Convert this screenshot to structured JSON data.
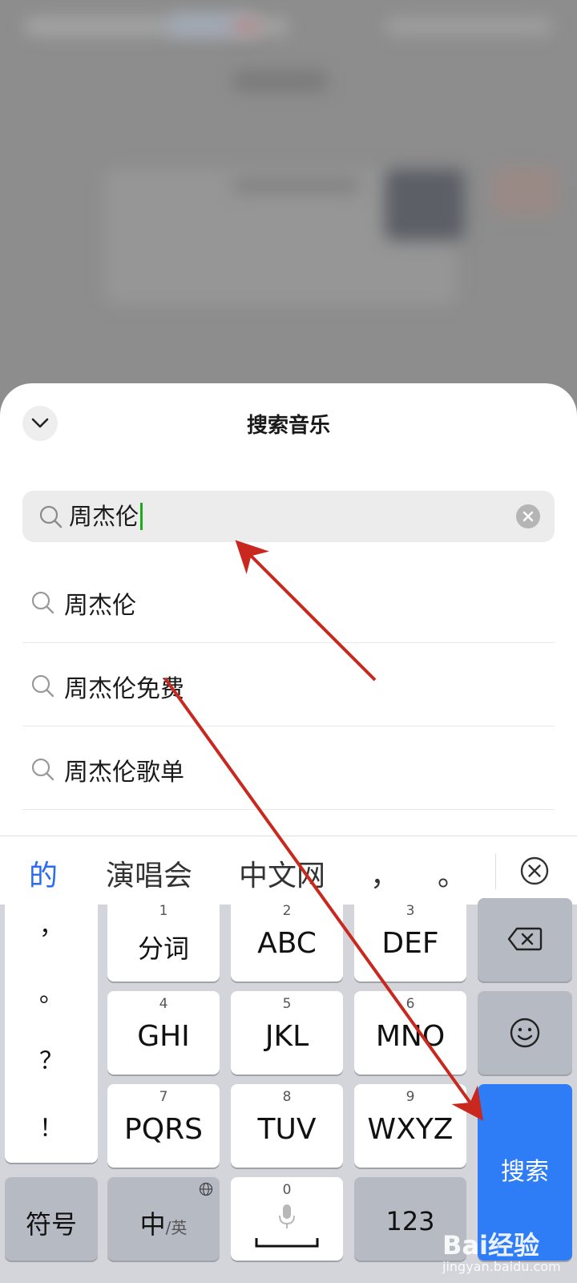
{
  "sheet": {
    "title": "搜索音乐"
  },
  "search": {
    "value": "周杰伦"
  },
  "suggestions": [
    {
      "label": "周杰伦"
    },
    {
      "label": "周杰伦免费"
    },
    {
      "label": "周杰伦歌单"
    }
  ],
  "candidates": [
    "的",
    "演唱会",
    "中文网",
    "，",
    "。"
  ],
  "keyboard": {
    "punct": [
      "，",
      "。",
      "？",
      "！"
    ],
    "keys": [
      {
        "num": "1",
        "label": "分词"
      },
      {
        "num": "2",
        "label": "ABC"
      },
      {
        "num": "3",
        "label": "DEF"
      },
      {
        "num": "4",
        "label": "GHI"
      },
      {
        "num": "5",
        "label": "JKL"
      },
      {
        "num": "6",
        "label": "MNO"
      },
      {
        "num": "7",
        "label": "PQRS"
      },
      {
        "num": "8",
        "label": "TUV"
      },
      {
        "num": "9",
        "label": "WXYZ"
      }
    ],
    "symbol_label": "符号",
    "lang_label": "中",
    "lang_alt": "/英",
    "space_num": "0",
    "num_label": "123",
    "search_label": "搜索"
  },
  "watermark": {
    "logo": "Bai经验",
    "url": "jingyan.baidu.com"
  },
  "colors": {
    "accent_blue": "#2e7cf6",
    "candidate_highlight": "#2a6cf0",
    "caret_green": "#1aad19",
    "annotation_red": "#c8281e"
  }
}
